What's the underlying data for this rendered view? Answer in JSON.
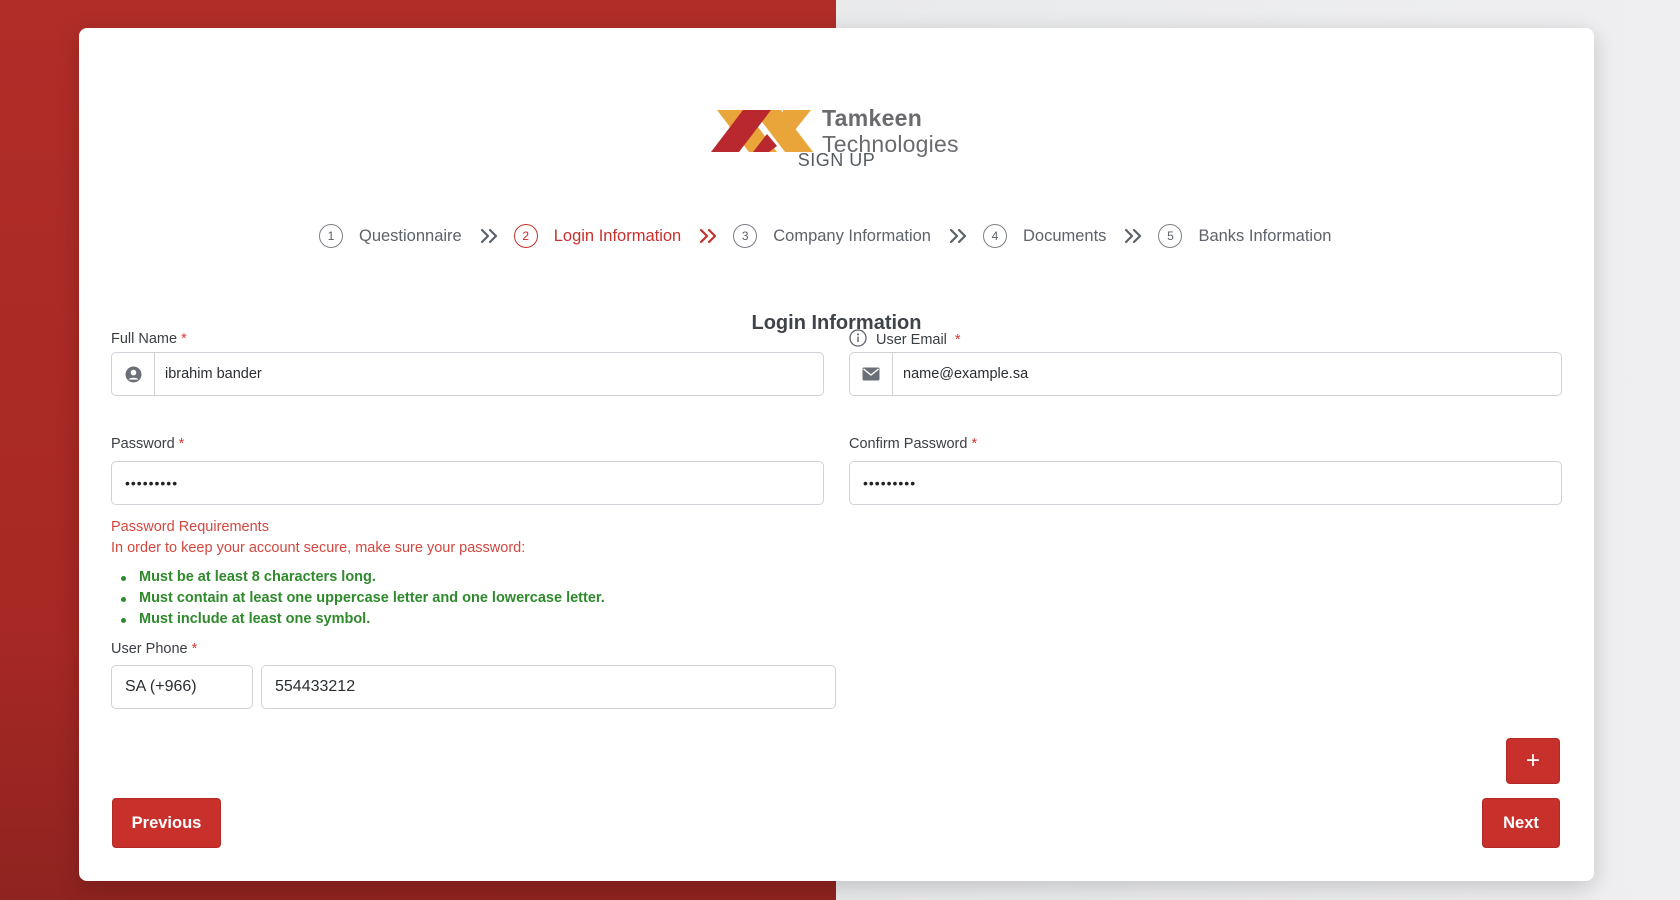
{
  "brand": {
    "name_line1": "Tamkeen",
    "name_line2": "Technologies",
    "colors": {
      "orange": "#e9a53a",
      "red": "#b8282e",
      "primary": "#c8312b"
    }
  },
  "page_title": "SIGN UP",
  "steps": [
    {
      "num": "1",
      "label": "Questionnaire",
      "active": false
    },
    {
      "num": "2",
      "label": "Login Information",
      "active": true
    },
    {
      "num": "3",
      "label": "Company Information",
      "active": false
    },
    {
      "num": "4",
      "label": "Documents",
      "active": false
    },
    {
      "num": "5",
      "label": "Banks Information",
      "active": false
    }
  ],
  "section_title": "Login Information",
  "form": {
    "full_name": {
      "label": "Full Name",
      "required": "*",
      "value": "ibrahim bander",
      "icon": "user-circle-icon"
    },
    "user_email": {
      "label": "User Email",
      "required": "*",
      "value": "name@example.sa",
      "icon": "envelope-icon",
      "info_icon": "info-icon"
    },
    "password": {
      "label": "Password",
      "required": "*",
      "value": "•••••••••"
    },
    "confirm_password": {
      "label": "Confirm Password",
      "required": "*",
      "value": "•••••••••"
    },
    "password_requirements": {
      "title": "Password Requirements",
      "description": "In order to keep your account secure, make sure your password:",
      "items": [
        "Must be at least 8 characters long.",
        "Must contain at least one uppercase letter and one lowercase letter.",
        "Must include at least one symbol."
      ]
    },
    "user_phone": {
      "label": "User Phone",
      "required": "*",
      "country_code": "SA (+966)",
      "value": "554433212"
    }
  },
  "buttons": {
    "add": "+",
    "previous": "Previous",
    "next": "Next"
  }
}
